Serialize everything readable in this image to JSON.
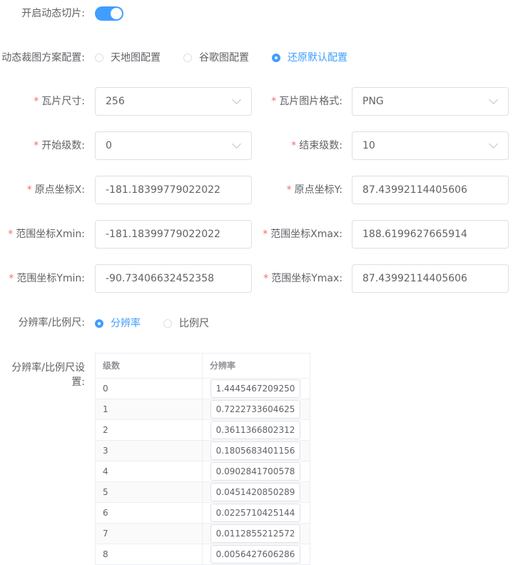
{
  "dynamic_tile": {
    "label": "开启动态切片:",
    "enabled": true
  },
  "crop_scheme": {
    "label": "动态裁图方案配置:",
    "options": [
      "天地图配置",
      "谷歌图配置",
      "还原默认配置"
    ],
    "selected": "还原默认配置"
  },
  "fields": {
    "tile_size": {
      "label": "瓦片尺寸:",
      "value": "256"
    },
    "tile_format": {
      "label": "瓦片图片格式:",
      "value": "PNG"
    },
    "start_level": {
      "label": "开始级数:",
      "value": "0"
    },
    "end_level": {
      "label": "结束级数:",
      "value": "10"
    },
    "origin_x": {
      "label": "原点坐标X:",
      "value": "-181.18399779022022"
    },
    "origin_y": {
      "label": "原点坐标Y:",
      "value": "87.43992114405606"
    },
    "xmin": {
      "label": "范围坐标Xmin:",
      "value": "-181.18399779022022"
    },
    "xmax": {
      "label": "范围坐标Xmax:",
      "value": "188.6199627665914"
    },
    "ymin": {
      "label": "范围坐标Ymin:",
      "value": "-90.73406632452358"
    },
    "ymax": {
      "label": "范围坐标Ymax:",
      "value": "87.43992114405606"
    }
  },
  "required_mark": "*",
  "res_type": {
    "label": "分辨率/比例尺:",
    "options": [
      "分辨率",
      "比例尺"
    ],
    "selected": "分辨率"
  },
  "res_table": {
    "label": "分辨率/比例尺设置:",
    "headers": [
      "级数",
      "分辨率"
    ],
    "rows": [
      [
        "0",
        "1.4445467209250"
      ],
      [
        "1",
        "0.7222733604625"
      ],
      [
        "2",
        "0.3611366802312"
      ],
      [
        "3",
        "0.1805683401156"
      ],
      [
        "4",
        "0.0902841700578"
      ],
      [
        "5",
        "0.0451420850289"
      ],
      [
        "6",
        "0.0225710425144"
      ],
      [
        "7",
        "0.0112855212572"
      ],
      [
        "8",
        "0.0056427606286"
      ]
    ]
  },
  "colors": {
    "primary": "#409eff",
    "required": "#f56c6c",
    "text": "#606266"
  }
}
